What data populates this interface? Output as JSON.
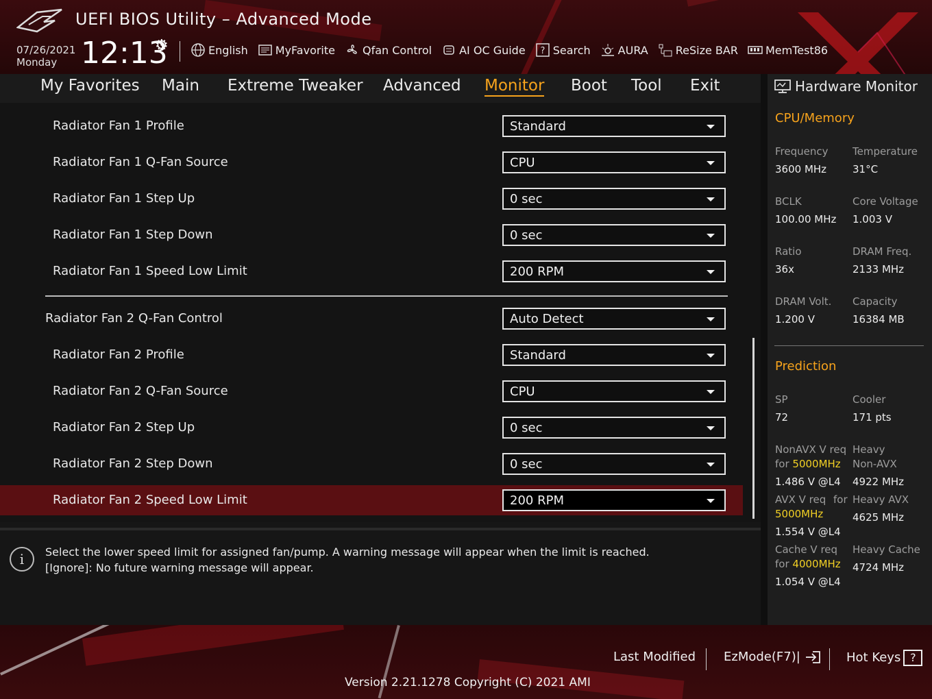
{
  "header": {
    "title": "UEFI BIOS Utility – Advanced Mode",
    "date": "07/26/2021",
    "day": "Monday",
    "time": "12:13"
  },
  "toolbar": {
    "items": [
      {
        "label": "English",
        "icon": "globe-icon"
      },
      {
        "label": "MyFavorite",
        "icon": "favorite-icon"
      },
      {
        "label": "Qfan Control",
        "icon": "fan-icon"
      },
      {
        "label": "AI OC Guide",
        "icon": "ai-chip-icon"
      },
      {
        "label": "Search",
        "icon": "search-icon"
      },
      {
        "label": "AURA",
        "icon": "aura-icon"
      },
      {
        "label": "ReSize BAR",
        "icon": "resize-bar-icon"
      },
      {
        "label": "MemTest86",
        "icon": "memtest-icon"
      }
    ]
  },
  "menu": {
    "items": [
      "My Favorites",
      "Main",
      "Extreme Tweaker",
      "Advanced",
      "Monitor",
      "Boot",
      "Tool",
      "Exit"
    ],
    "active": "Monitor"
  },
  "settings": [
    {
      "label": "Radiator Fan 1 Profile",
      "value": "Standard"
    },
    {
      "label": "Radiator Fan 1 Q-Fan Source",
      "value": "CPU"
    },
    {
      "label": "Radiator Fan 1 Step Up",
      "value": "0 sec"
    },
    {
      "label": "Radiator Fan 1 Step Down",
      "value": "0 sec"
    },
    {
      "label": "Radiator Fan 1 Speed Low Limit",
      "value": "200 RPM"
    },
    {
      "label": "Radiator Fan 2 Q-Fan Control",
      "value": "Auto Detect"
    },
    {
      "label": "Radiator Fan 2 Profile",
      "value": "Standard"
    },
    {
      "label": "Radiator Fan 2 Q-Fan Source",
      "value": "CPU"
    },
    {
      "label": "Radiator Fan 2 Step Up",
      "value": "0 sec"
    },
    {
      "label": "Radiator Fan 2 Step Down",
      "value": "0 sec"
    },
    {
      "label": "Radiator Fan 2 Speed Low Limit",
      "value": "200 RPM"
    }
  ],
  "help": {
    "line1": "Select the lower speed limit for assigned fan/pump. A warning message will appear when the limit is reached.",
    "line2": "[Ignore]: No future warning message will appear."
  },
  "hw": {
    "title": "Hardware Monitor",
    "cpu_section": "CPU/Memory",
    "frequency_k": "Frequency",
    "frequency_v": "3600 MHz",
    "temperature_k": "Temperature",
    "temperature_v": "31°C",
    "bclk_k": "BCLK",
    "bclk_v": "100.00 MHz",
    "corevolt_k": "Core Voltage",
    "corevolt_v": "1.003 V",
    "ratio_k": "Ratio",
    "ratio_v": "36x",
    "dramfreq_k": "DRAM Freq.",
    "dramfreq_v": "2133 MHz",
    "dramvolt_k": "DRAM Volt.",
    "dramvolt_v": "1.200 V",
    "capacity_k": "Capacity",
    "capacity_v": "16384 MB",
    "pred_section": "Prediction",
    "sp_k": "SP",
    "sp_v": "72",
    "cooler_k": "Cooler",
    "cooler_v": "171 pts",
    "nonavx_k1": "NonAVX V req",
    "nonavx_for": "for",
    "nonavx_freq": "5000MHz",
    "nonavx_v": "1.486 V @L4",
    "heavy_nonavx_k1": "Heavy",
    "heavy_nonavx_k2": "Non-AVX",
    "heavy_nonavx_v": "4922 MHz",
    "avx_k1": "AVX V req",
    "avx_for": "for",
    "avx_freq": "5000MHz",
    "avx_v": "1.554 V @L4",
    "heavy_avx_k": "Heavy AVX",
    "heavy_avx_v": "4625 MHz",
    "cache_k1": "Cache V req",
    "cache_for": "for",
    "cache_freq": "4000MHz",
    "cache_v": "1.054 V @L4",
    "heavy_cache_k": "Heavy Cache",
    "heavy_cache_v": "4724 MHz"
  },
  "footer": {
    "last_modified": "Last Modified",
    "ezmode": "EzMode(F7)|",
    "hotkeys": "Hot Keys",
    "hotkeys_key": "?",
    "version": "Version 2.21.1278 Copyright (C) 2021 AMI"
  },
  "colors": {
    "accent": "#f7a31c",
    "highlight": "#f2d024",
    "selected_row": "#5a0f12"
  }
}
